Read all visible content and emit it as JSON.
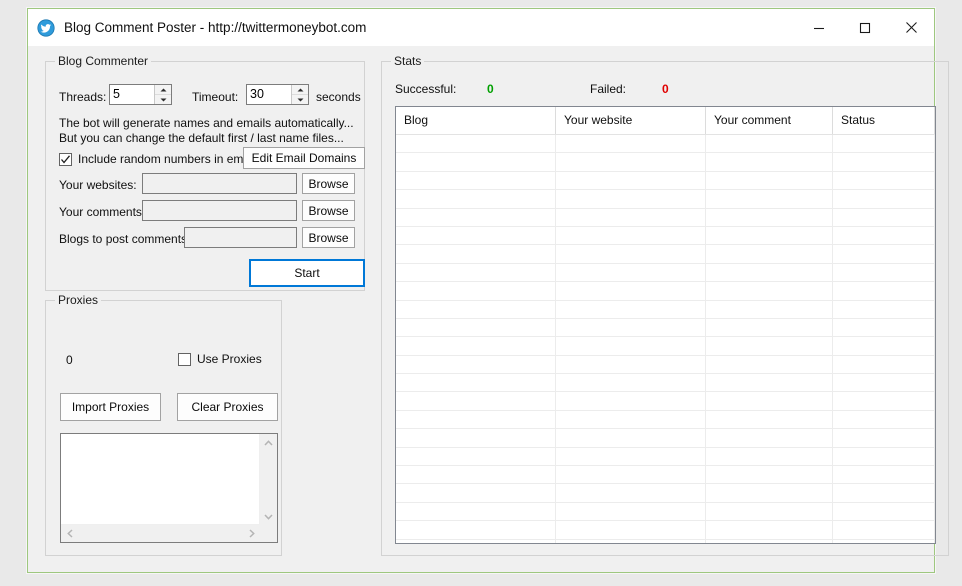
{
  "window": {
    "title": "Blog Comment Poster - http://twittermoneybot.com",
    "icon": "twitter-bird-icon",
    "minimize_label": "Minimize",
    "maximize_label": "Maximize",
    "close_label": "Close",
    "border_color": "#9ec77f"
  },
  "commenter": {
    "group_label": "Blog Commenter",
    "threads_label": "Threads:",
    "threads_value": "5",
    "timeout_label": "Timeout:",
    "timeout_value": "30",
    "seconds_label": "seconds",
    "info_line_1": "The bot will generate names and emails automatically...",
    "info_line_2": "But you can change the default first / last name files...",
    "random_numbers_label": "Include random numbers in emails",
    "random_numbers_checked": true,
    "edit_email_domains_label": "Edit Email Domains",
    "websites_label": "Your websites:",
    "websites_value": "",
    "comments_label": "Your comments:",
    "comments_value": "",
    "blogs_label": "Blogs to post comments:",
    "blogs_value": "",
    "browse_label": "Browse",
    "start_label": "Start",
    "start_accent": "#0078d7"
  },
  "proxies": {
    "group_label": "Proxies",
    "count": "0",
    "use_proxies_label": "Use Proxies",
    "use_proxies_checked": false,
    "import_label": "Import Proxies",
    "clear_label": "Clear Proxies",
    "list_items": []
  },
  "stats": {
    "group_label": "Stats",
    "successful_label": "Successful:",
    "successful_value": "0",
    "successful_color": "#00a000",
    "failed_label": "Failed:",
    "failed_value": "0",
    "failed_color": "#e00000",
    "columns": [
      "Blog",
      "Your website",
      "Your comment",
      "Status"
    ],
    "rows": []
  }
}
